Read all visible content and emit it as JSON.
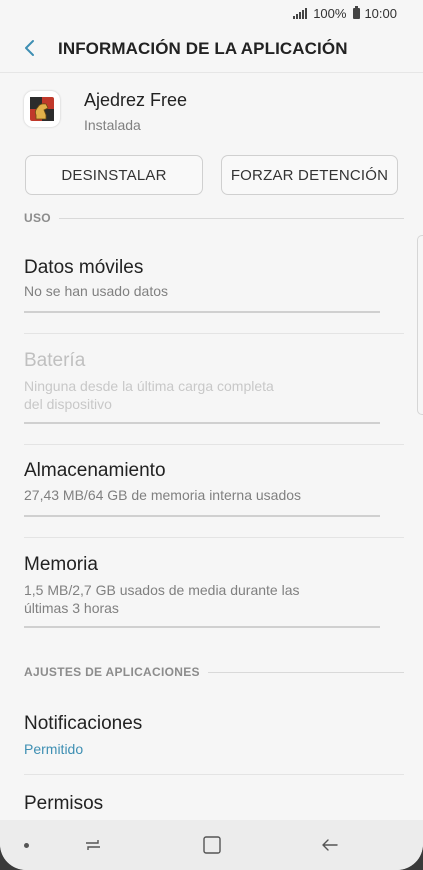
{
  "status_bar": {
    "battery": "100%",
    "time": "10:00"
  },
  "header": {
    "title": "INFORMACIÓN DE LA APLICACIÓN"
  },
  "app": {
    "name": "Ajedrez Free",
    "status": "Instalada"
  },
  "buttons": {
    "uninstall": "DESINSTALAR",
    "force_stop": "FORZAR DETENCIÓN"
  },
  "sections": {
    "usage": "USO",
    "app_settings": "AJUSTES DE APLICACIONES"
  },
  "usage_items": [
    {
      "title": "Datos móviles",
      "subtitle": "No se han usado datos"
    },
    {
      "title": "Batería",
      "subtitle_line1": "Ninguna desde la última carga completa",
      "subtitle_line2": "del dispositivo"
    },
    {
      "title": "Almacenamiento",
      "subtitle": "27,43 MB/64 GB de memoria interna usados"
    },
    {
      "title": "Memoria",
      "subtitle_line1": "1,5 MB/2,7 GB usados de media durante las",
      "subtitle_line2": "últimas 3 horas"
    }
  ],
  "settings_items": [
    {
      "title": "Notificaciones",
      "subtitle": "Permitido"
    },
    {
      "title": "Permisos"
    }
  ],
  "colors": {
    "accent": "#3e8fb3",
    "background": "#f6f6f6"
  },
  "icons": [
    "signal-icon",
    "battery-icon",
    "back-arrow-icon",
    "chess-app-icon",
    "recents-icon",
    "home-icon",
    "back-nav-icon"
  ]
}
